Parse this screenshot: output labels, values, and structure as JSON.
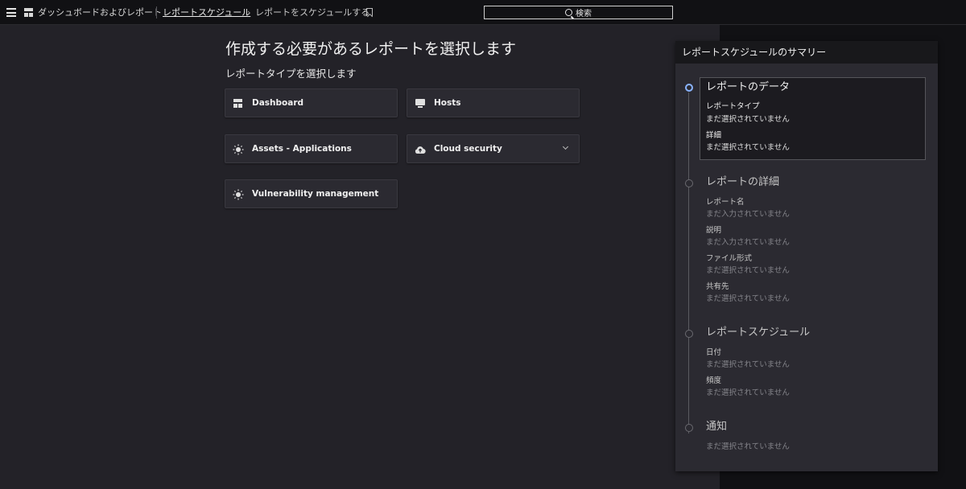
{
  "topbar": {
    "breadcrumb_home": "ダッシュボードおよびレポート",
    "breadcrumb_parent": "レポートスケジュール",
    "breadcrumb_separator": "›",
    "breadcrumb_current": "レポートをスケジュールする",
    "search_label": "検索"
  },
  "main": {
    "title": "作成する必要があるレポートを選択します",
    "subtitle": "レポートタイプを選択します",
    "tiles": [
      {
        "label": "Dashboard",
        "icon": "dashboard-icon"
      },
      {
        "label": "Hosts",
        "icon": "monitor-icon"
      },
      {
        "label": "Assets - Applications",
        "icon": "sun-icon"
      },
      {
        "label": "Cloud security",
        "icon": "cloud-upload-icon"
      },
      {
        "label": "Vulnerability management",
        "icon": "sun-icon"
      }
    ]
  },
  "summary": {
    "title": "レポートスケジュールのサマリー",
    "steps": [
      {
        "title": "レポートのデータ",
        "fields": [
          {
            "label": "レポートタイプ",
            "value": "まだ選択されていません"
          },
          {
            "label": "詳細",
            "value": "まだ選択されていません"
          }
        ]
      },
      {
        "title": "レポートの詳細",
        "fields": [
          {
            "label": "レポート名",
            "value": "まだ入力されていません"
          },
          {
            "label": "説明",
            "value": "まだ入力されていません"
          },
          {
            "label": "ファイル形式",
            "value": "まだ選択されていません"
          },
          {
            "label": "共有先",
            "value": "まだ選択されていません"
          }
        ]
      },
      {
        "title": "レポートスケジュール",
        "fields": [
          {
            "label": "日付",
            "value": "まだ選択されていません"
          },
          {
            "label": "頻度",
            "value": "まだ選択されていません"
          }
        ]
      },
      {
        "title": "通知",
        "fields": [
          {
            "label": "",
            "value": "まだ選択されていません"
          }
        ]
      }
    ]
  },
  "colors": {
    "accent": "#8ab4ff",
    "main_bg": "#232228",
    "panel_bg": "#2b2a31"
  }
}
